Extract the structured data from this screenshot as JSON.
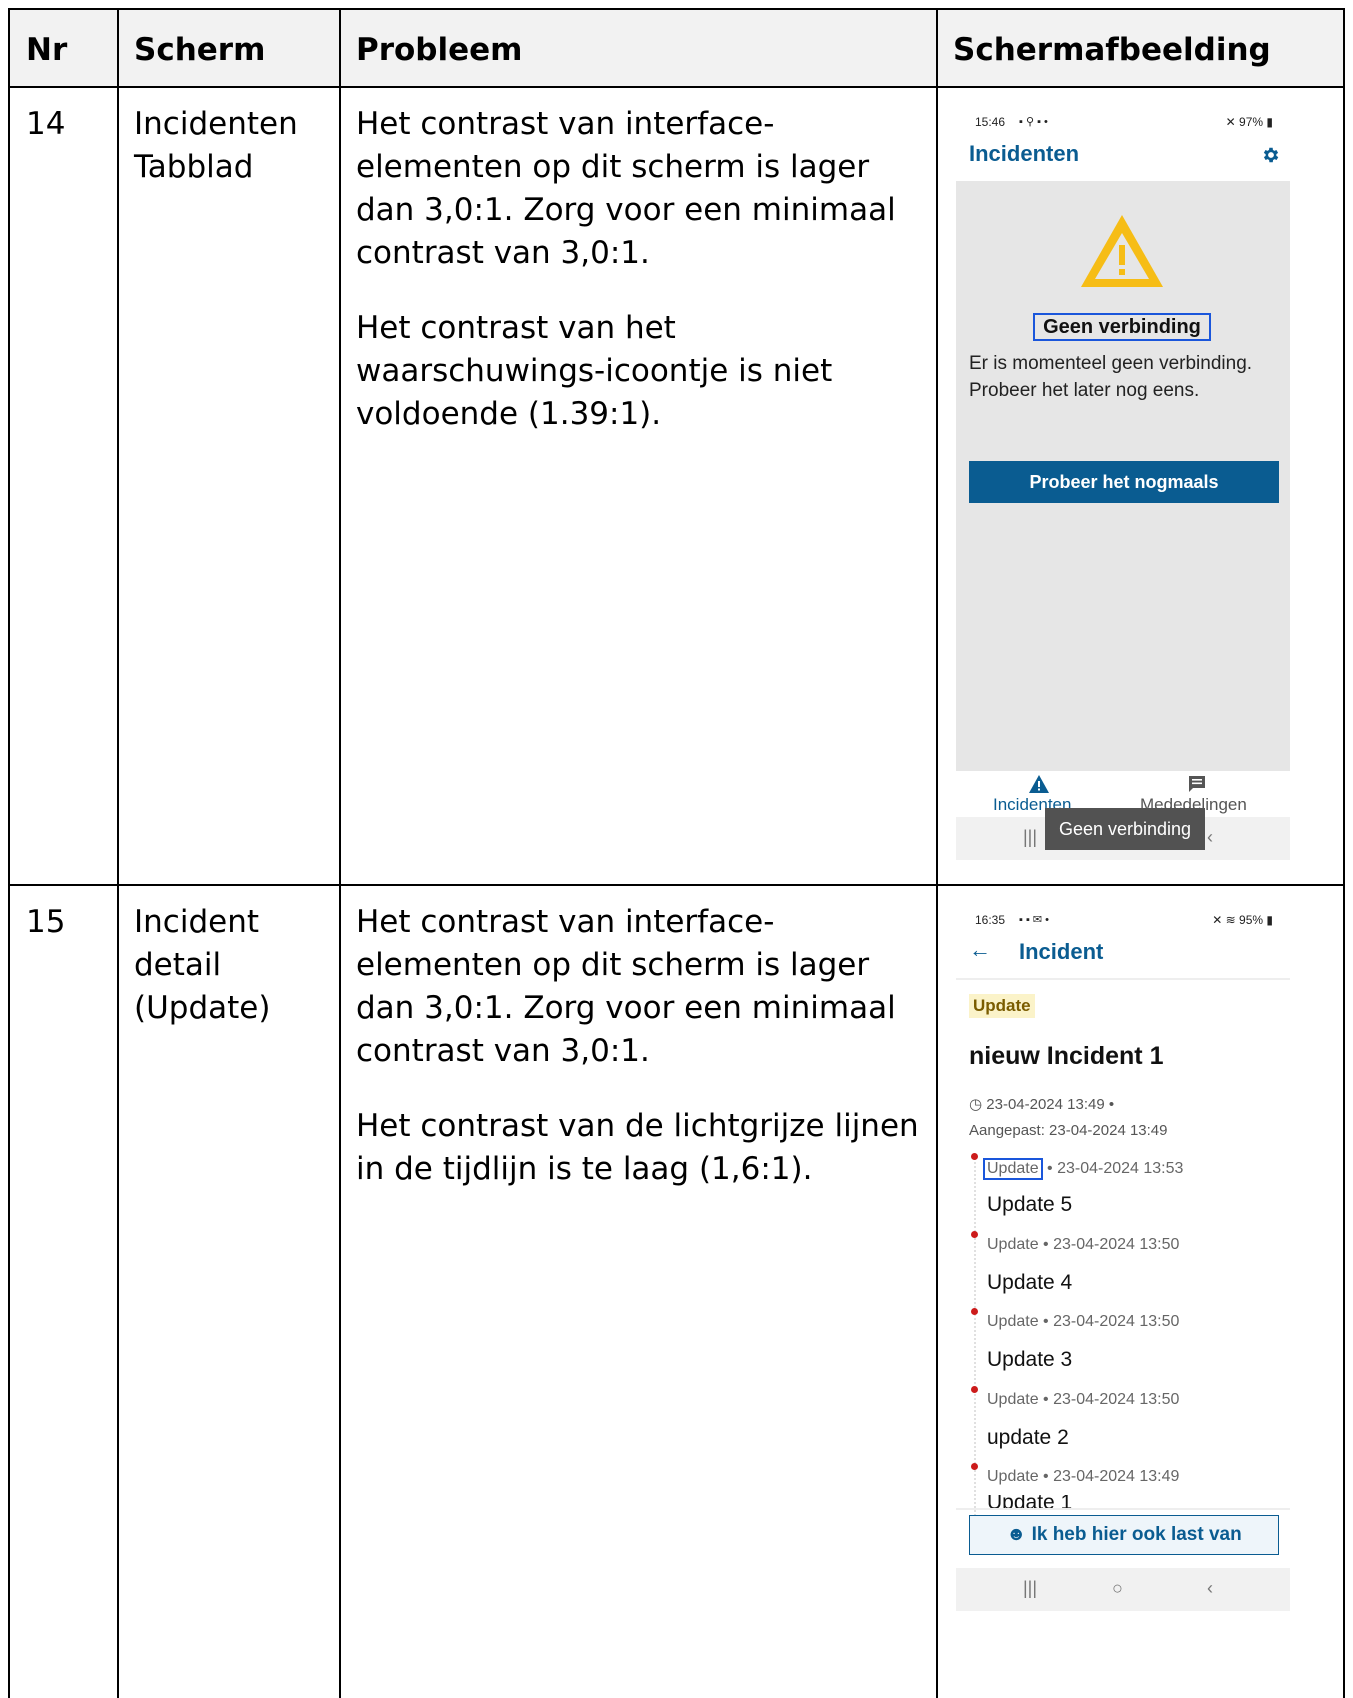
{
  "table": {
    "headers": [
      "Nr",
      "Scherm",
      "Probleem",
      "Schermafbeelding"
    ],
    "rows": [
      {
        "nr": "14",
        "scherm": "Incidenten Tabblad",
        "probleem": [
          "Het contrast van interface-elementen op dit scherm is lager dan 3,0:1. Zorg voor een minimaal contrast van 3,0:1.",
          "Het contrast van het waarschuwings-icoontje is niet voldoende (1.39:1)."
        ]
      },
      {
        "nr": "15",
        "scherm": "Incident detail (Update)",
        "probleem": [
          "Het contrast van interface-elementen op dit scherm is lager dan 3,0:1. Zorg voor een minimaal contrast van 3,0:1.",
          "Het contrast van de lichtgrijze lijnen in de tijdlijn is te laag (1,6:1)."
        ]
      }
    ]
  },
  "screen1": {
    "status_time": "15:46",
    "status_right": "97%",
    "title": "Incidenten",
    "error_title": "Geen verbinding",
    "error_text": "Er is momenteel geen verbinding. Probeer het later nog eens.",
    "retry_button": "Probeer het nogmaals",
    "nav": [
      "Incidenten",
      "Mededelingen"
    ],
    "tooltip": "Geen verbinding",
    "icons": {
      "warning": "warning-triangle-icon",
      "settings": "gear-icon",
      "messages": "message-icon"
    },
    "colors": {
      "brand": "#0a5c91",
      "warning": "#f6bd16",
      "focus": "#1a56db"
    }
  },
  "screen2": {
    "status_time": "16:35",
    "status_right": "95%",
    "title": "Incident",
    "badge": "Update",
    "incident_title": "nieuw Incident 1",
    "created": "23-04-2024 13:49",
    "modified": "Aangepast: 23-04-2024 13:49",
    "timeline": [
      {
        "type": "Update",
        "date": "23-04-2024 13:53",
        "title": "Update 5"
      },
      {
        "type": "Update",
        "date": "23-04-2024 13:50",
        "title": "Update 4"
      },
      {
        "type": "Update",
        "date": "23-04-2024 13:50",
        "title": "Update 3"
      },
      {
        "type": "Update",
        "date": "23-04-2024 13:50",
        "title": "update 2"
      },
      {
        "type": "Update",
        "date": "23-04-2024 13:49",
        "title": "Update 1"
      }
    ],
    "button": "Ik heb hier ook last van",
    "colors": {
      "badge_bg": "#fbf3c9",
      "badge_text": "#7a5c00",
      "dot": "#cc1b1b"
    }
  }
}
